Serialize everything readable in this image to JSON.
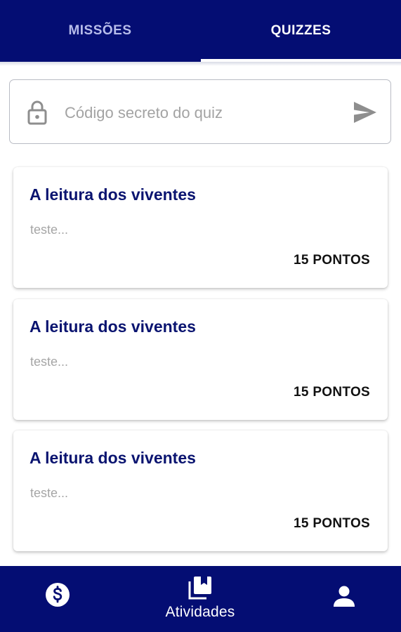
{
  "tabs": [
    {
      "label": "MISSÕES",
      "active": false
    },
    {
      "label": "QUIZZES",
      "active": true
    }
  ],
  "search": {
    "placeholder": "Código secreto do quiz",
    "value": "",
    "lock_icon": "lock-icon",
    "send_icon": "send-icon"
  },
  "quizzes": [
    {
      "title": "A leitura dos viventes",
      "description": "teste...",
      "points": "15 PONTOS"
    },
    {
      "title": "A leitura dos viventes",
      "description": "teste...",
      "points": "15 PONTOS"
    },
    {
      "title": "A leitura dos viventes",
      "description": "teste...",
      "points": "15 PONTOS"
    }
  ],
  "bottom_nav": {
    "items": [
      {
        "icon": "dollar-icon",
        "label": ""
      },
      {
        "icon": "library-books-icon",
        "label": "Atividades"
      },
      {
        "icon": "person-icon",
        "label": ""
      }
    ]
  },
  "colors": {
    "primary": "#040d73",
    "card_title": "#0a1470",
    "inactive_tab": "#b7bcea",
    "placeholder": "#a3a3a3"
  }
}
